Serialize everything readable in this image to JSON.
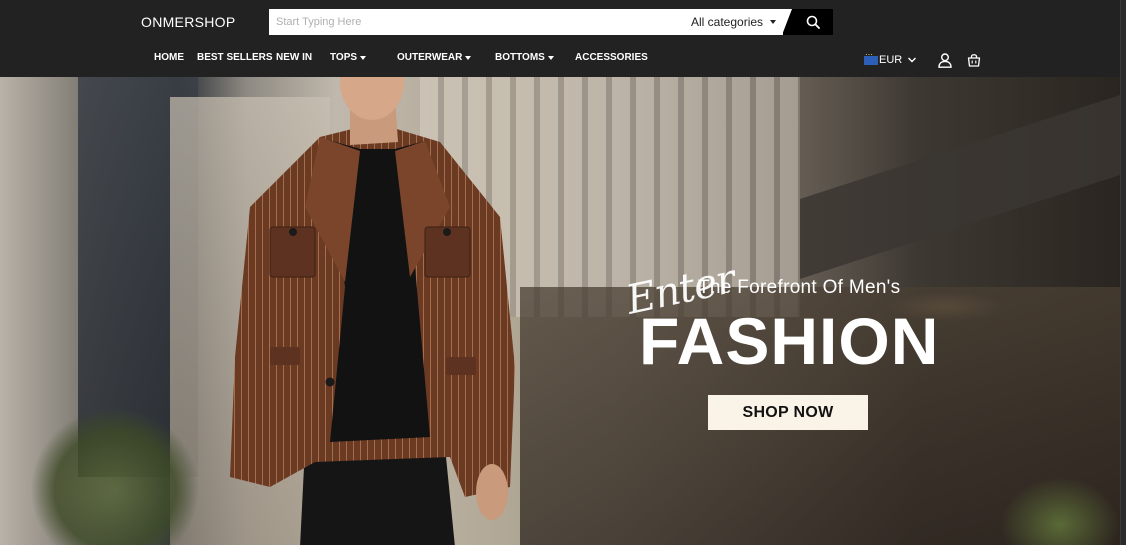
{
  "header": {
    "logo": "ONMERSHOP",
    "search": {
      "placeholder": "Start Typing Here",
      "category_label": "All categories"
    },
    "nav": [
      {
        "label": "HOME",
        "has_dropdown": false
      },
      {
        "label": "BEST SELLERS",
        "has_dropdown": false
      },
      {
        "label": "NEW IN",
        "has_dropdown": false
      },
      {
        "label": "TOPS",
        "has_dropdown": true
      },
      {
        "label": "OUTERWEAR",
        "has_dropdown": true
      },
      {
        "label": "BOTTOMS",
        "has_dropdown": true
      },
      {
        "label": "ACCESSORIES",
        "has_dropdown": false
      }
    ],
    "currency": "EUR",
    "icons": [
      "search-icon",
      "flag-icon",
      "chevron-down-icon",
      "user-icon",
      "shopping-bag-icon"
    ]
  },
  "hero": {
    "script": "Enter",
    "subtitle": "The Forefront Of Men's",
    "title": "FASHION",
    "cta_label": "SHOP NOW"
  },
  "colors": {
    "header_bg": "#222222",
    "cta_bg": "#faf3e8",
    "text_light": "#ffffff"
  }
}
